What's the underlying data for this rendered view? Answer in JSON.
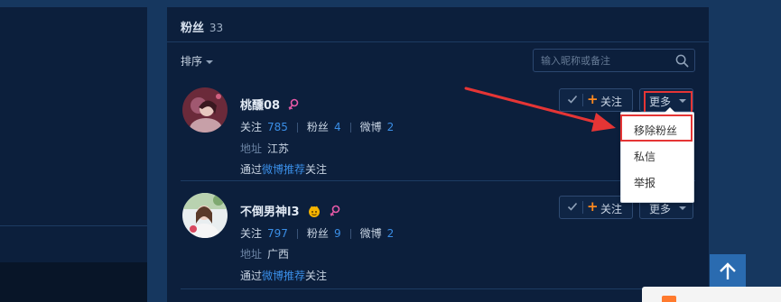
{
  "fans": {
    "title": "粉丝",
    "count": "33",
    "sort_label": "排序",
    "search_placeholder": "输入昵称或备注"
  },
  "users": [
    {
      "name": "桃醺08",
      "gender": "female",
      "following_label": "关注",
      "following": "785",
      "fans_label": "粉丝",
      "fans": "4",
      "weibo_label": "微博",
      "weibo": "2",
      "address_label": "地址",
      "address": "江苏",
      "via_prefix": "通过",
      "via_link": "微博推荐",
      "via_suffix": "关注",
      "follow_label": "关注",
      "more_label": "更多"
    },
    {
      "name": "不倒男神l3",
      "gender": "female",
      "badge": "crown-icon",
      "following_label": "关注",
      "following": "797",
      "fans_label": "粉丝",
      "fans": "9",
      "weibo_label": "微博",
      "weibo": "2",
      "address_label": "地址",
      "address": "广西",
      "via_prefix": "通过",
      "via_link": "微博推荐",
      "via_suffix": "关注",
      "follow_label": "关注",
      "more_label": "更多"
    }
  ],
  "dropdown": {
    "items": [
      "移除粉丝",
      "私信",
      "举报"
    ]
  },
  "colors": {
    "background": "#16375f",
    "panel": "#0c1f3c",
    "link": "#3a8ee6",
    "accent_orange": "#ff8a1f",
    "highlight_red": "#e53535",
    "scroll_top_button": "#2a6bb0"
  }
}
